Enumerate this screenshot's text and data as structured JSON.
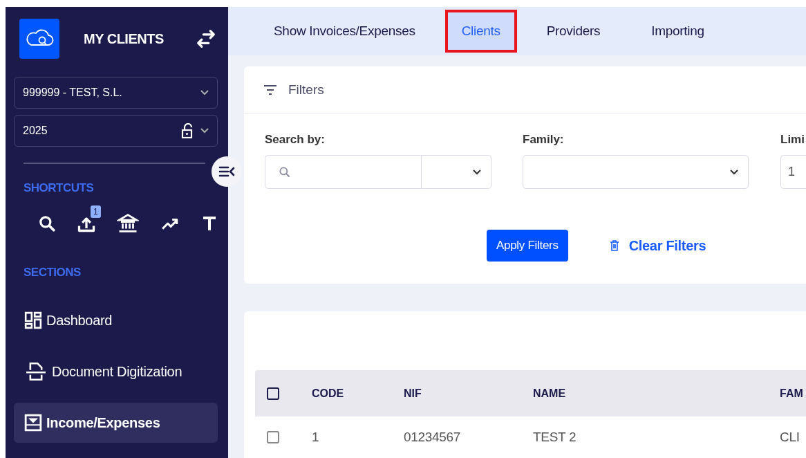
{
  "sidebar": {
    "title": "MY CLIENTS",
    "company_select": {
      "value": "999999 - TEST, S.L."
    },
    "year_select": {
      "value": "2025",
      "locked": false
    },
    "shortcuts_heading": "SHORTCUTS",
    "shortcuts": [
      {
        "kind": "search"
      },
      {
        "kind": "upload",
        "badge": "1"
      },
      {
        "kind": "bank"
      },
      {
        "kind": "trend"
      },
      {
        "kind": "text"
      }
    ],
    "sections_heading": "SECTIONS",
    "items": [
      {
        "label": "Dashboard",
        "kind": "dashboard",
        "selected": false
      },
      {
        "label": "Document Digitization",
        "kind": "scan",
        "selected": false
      },
      {
        "label": "Income/Expenses",
        "kind": "inbox",
        "selected": true
      }
    ]
  },
  "tabs": [
    {
      "label": "Show Invoices/Expenses",
      "selected": false,
      "highlighted": false
    },
    {
      "label": "Clients",
      "selected": true,
      "highlighted": true
    },
    {
      "label": "Providers",
      "selected": false,
      "highlighted": false
    },
    {
      "label": "Importing",
      "selected": false,
      "highlighted": false
    }
  ],
  "filters": {
    "title": "Filters",
    "fields": [
      {
        "label": "Search by:",
        "kind": "search"
      },
      {
        "label": "Family:",
        "kind": "select"
      },
      {
        "label": "Limi",
        "kind": "text",
        "value": "1"
      }
    ],
    "apply_button": "Apply Filters",
    "clear_button": "Clear Filters"
  },
  "table": {
    "select_all_checked": false,
    "columns": [
      "CODE",
      "NIF",
      "NAME",
      "FAM"
    ],
    "rows": [
      {
        "checked": false,
        "cells": [
          "1",
          "01234567",
          "TEST 2",
          "CLI"
        ]
      }
    ]
  }
}
